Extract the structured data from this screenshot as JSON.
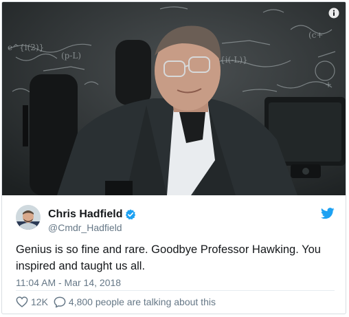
{
  "media": {
    "description_icon": "info-icon"
  },
  "author": {
    "name": "Chris Hadfield",
    "handle": "@Cmdr_Hadfield",
    "verified_icon": "verified-badge-icon",
    "brand_icon": "twitter-bird-icon"
  },
  "tweet": {
    "text": "Genius is so fine and rare. Goodbye Professor Hawking. You inspired and taught us all.",
    "timestamp": "11:04 AM - Mar 14, 2018"
  },
  "actions": {
    "likes_count": "12K",
    "like_icon": "heart-icon",
    "reply_icon": "speech-bubble-icon",
    "talking_text": "4,800 people are talking about this"
  },
  "colors": {
    "brand_blue": "#1da1f2",
    "text_primary": "#14171a",
    "text_secondary": "#657786"
  }
}
